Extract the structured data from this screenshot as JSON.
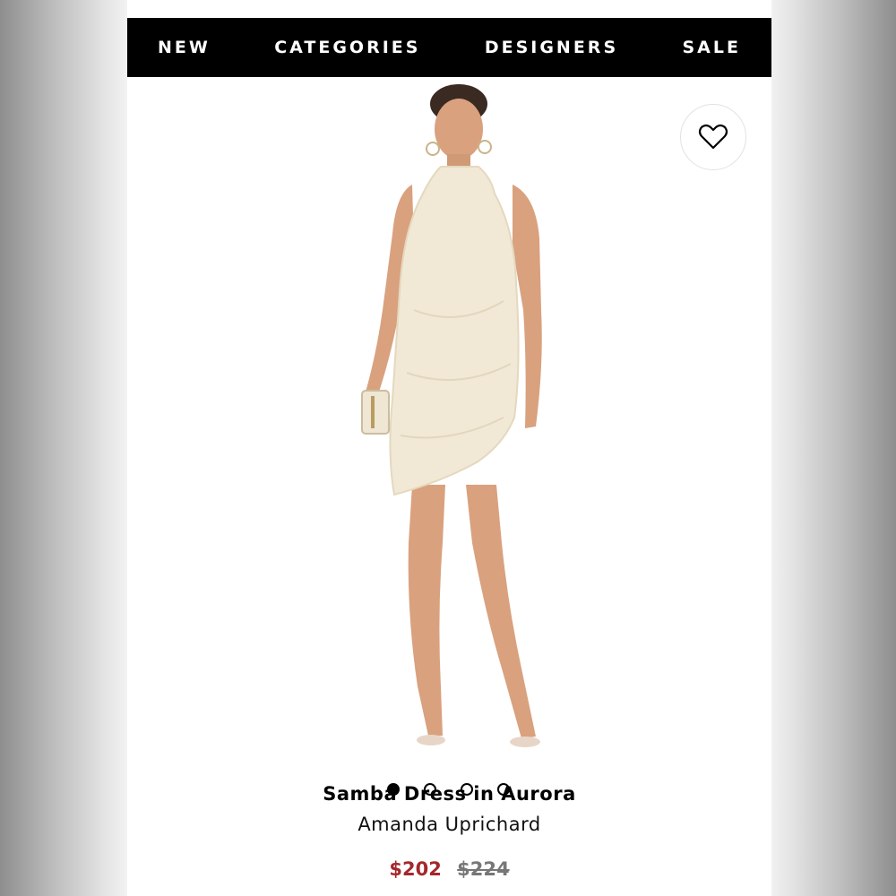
{
  "nav": {
    "items": [
      {
        "label": "NEW"
      },
      {
        "label": "CATEGORIES"
      },
      {
        "label": "DESIGNERS"
      },
      {
        "label": "SALE"
      }
    ]
  },
  "gallery": {
    "image_count": 4,
    "active_index": 0
  },
  "product": {
    "title": "Samba Dress in Aurora",
    "brand": "Amanda Uprichard",
    "sale_price": "$202",
    "original_price": "$224"
  },
  "colors": {
    "nav_bg": "#000000",
    "sale_price": "#a5272d",
    "original_price": "#777777"
  },
  "icons": {
    "favorite": "heart-outline-icon"
  }
}
